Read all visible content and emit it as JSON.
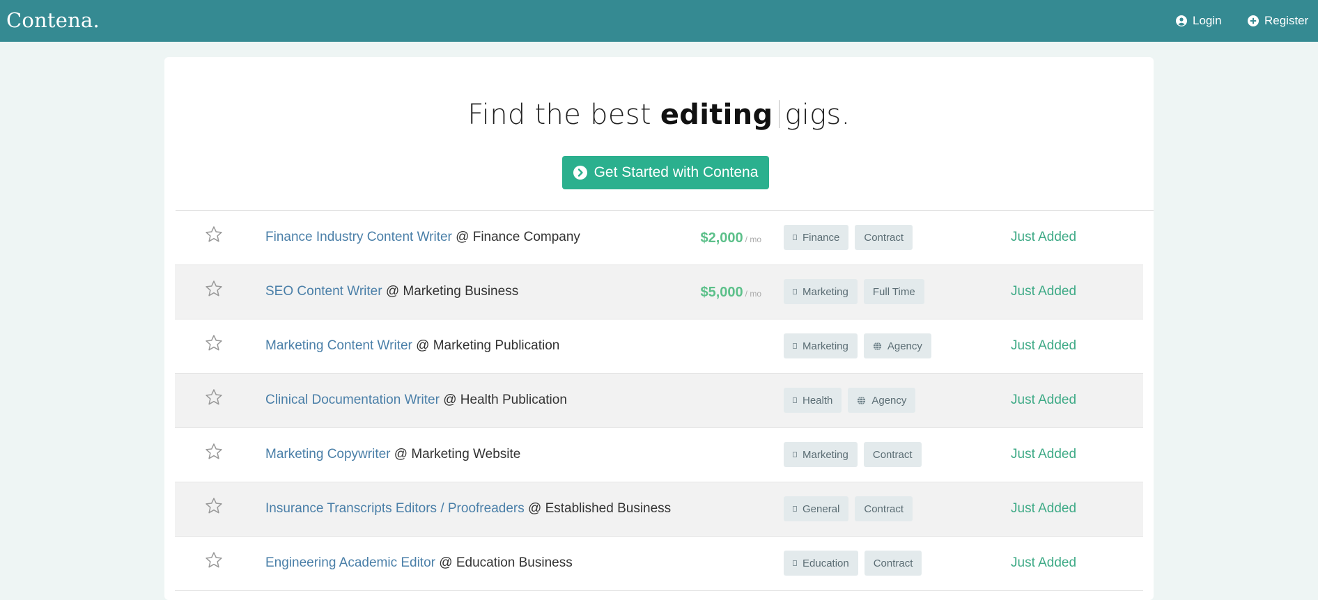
{
  "header": {
    "logo": "Contena.",
    "login_label": "Login",
    "register_label": "Register",
    "bg_color": "#358a92"
  },
  "hero": {
    "prefix": "Find the best",
    "highlight": "editing",
    "suffix": "gigs.",
    "cta_label": "Get Started with Contena",
    "cta_color": "#2bb08e"
  },
  "jobs": [
    {
      "title": "Finance Industry Content Writer",
      "company": "@ Finance Company",
      "salary": "$2,000",
      "period": "/ mo",
      "tags": [
        {
          "label": "Finance",
          "icon": "category-icon"
        },
        {
          "label": "Contract",
          "icon": ""
        }
      ],
      "status": "Just Added"
    },
    {
      "title": "SEO Content Writer",
      "company": "@ Marketing Business",
      "salary": "$5,000",
      "period": "/ mo",
      "tags": [
        {
          "label": "Marketing",
          "icon": "category-icon"
        },
        {
          "label": "Full Time",
          "icon": ""
        }
      ],
      "status": "Just Added"
    },
    {
      "title": "Marketing Content Writer",
      "company": "@ Marketing Publication",
      "salary": "",
      "period": "",
      "tags": [
        {
          "label": "Marketing",
          "icon": "category-icon"
        },
        {
          "label": "Agency",
          "icon": "globe-icon"
        }
      ],
      "status": "Just Added"
    },
    {
      "title": "Clinical Documentation Writer",
      "company": "@ Health Publication",
      "salary": "",
      "period": "",
      "tags": [
        {
          "label": "Health",
          "icon": "category-icon"
        },
        {
          "label": "Agency",
          "icon": "globe-icon"
        }
      ],
      "status": "Just Added"
    },
    {
      "title": "Marketing Copywriter",
      "company": "@ Marketing Website",
      "salary": "",
      "period": "",
      "tags": [
        {
          "label": "Marketing",
          "icon": "category-icon"
        },
        {
          "label": "Contract",
          "icon": ""
        }
      ],
      "status": "Just Added"
    },
    {
      "title": "Insurance Transcripts Editors / Proofreaders",
      "company": "@ Established Business",
      "salary": "",
      "period": "",
      "tags": [
        {
          "label": "General",
          "icon": "category-icon"
        },
        {
          "label": "Contract",
          "icon": ""
        }
      ],
      "status": "Just Added"
    },
    {
      "title": "Engineering Academic Editor",
      "company": "@ Education Business",
      "salary": "",
      "period": "",
      "tags": [
        {
          "label": "Education",
          "icon": "category-icon"
        },
        {
          "label": "Contract",
          "icon": ""
        }
      ],
      "status": "Just Added"
    }
  ]
}
